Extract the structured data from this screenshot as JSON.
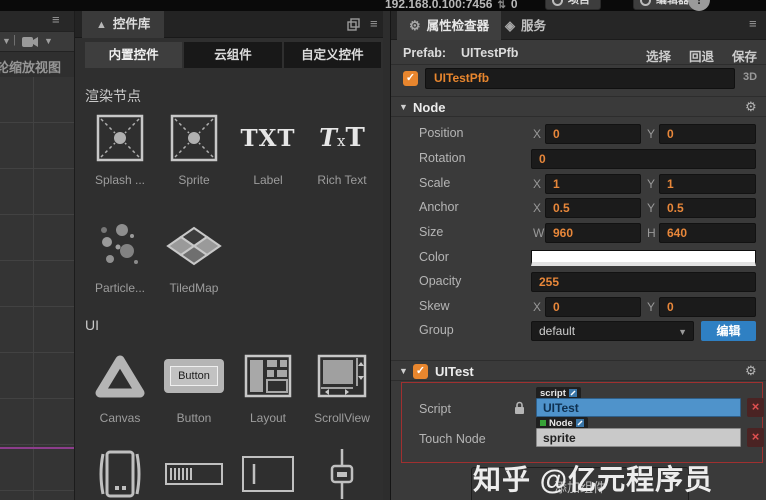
{
  "topbar": {
    "address": "192.168.0.100:7456",
    "count": "0",
    "project": "项目",
    "editor": "编辑器",
    "alert": "!"
  },
  "scene": {
    "hint": "轮缩放视图"
  },
  "library": {
    "title": "控件库",
    "tabs": [
      {
        "label": "内置控件"
      },
      {
        "label": "云组件"
      },
      {
        "label": "自定义控件"
      }
    ],
    "section_render": "渲染节点",
    "section_ui": "UI",
    "items": {
      "splash": "Splash ...",
      "sprite": "Sprite",
      "label": "Label",
      "richtext": "Rich Text",
      "particle": "Particle...",
      "tiledmap": "TiledMap",
      "canvas": "Canvas",
      "button": "Button",
      "layout": "Layout",
      "scrollview": "ScrollView"
    },
    "glyphs": {
      "label": "TXT",
      "rt1": "T",
      "rt2": "x",
      "rt3": "T",
      "button": "Button"
    }
  },
  "inspector": {
    "tab_inspector": "属性检查器",
    "tab_service": "服务",
    "prefab_label": "Prefab:",
    "prefab_name": "UITestPfb",
    "action_select": "选择",
    "action_revert": "回退",
    "action_save": "保存",
    "node_name": "UITestPfb",
    "mode": "3D",
    "node_section": "Node",
    "axis": {
      "x": "X",
      "y": "Y",
      "w": "W",
      "h": "H"
    },
    "rows": {
      "position": {
        "label": "Position",
        "x": "0",
        "y": "0"
      },
      "rotation": {
        "label": "Rotation",
        "value": "0"
      },
      "scale": {
        "label": "Scale",
        "x": "1",
        "y": "1"
      },
      "anchor": {
        "label": "Anchor",
        "x": "0.5",
        "y": "0.5"
      },
      "size": {
        "label": "Size",
        "w": "960",
        "h": "640"
      },
      "color": {
        "label": "Color",
        "value": "#FFFFFF"
      },
      "opacity": {
        "label": "Opacity",
        "value": "255"
      },
      "skew": {
        "label": "Skew",
        "x": "0",
        "y": "0"
      },
      "group": {
        "label": "Group",
        "value": "default",
        "edit": "编辑"
      }
    },
    "uitest": {
      "section": "UITest",
      "script_label": "Script",
      "script_tag": "script",
      "script_value": "UITest",
      "touch_label": "Touch Node",
      "touch_tag": "Node",
      "touch_value": "sprite",
      "remove": "×"
    },
    "add_component": "添加组件"
  },
  "watermark": "知乎 @亿元程序员",
  "icons": {
    "menu": "≡",
    "caret_down": "▼",
    "gear": "⚙",
    "check": "✓",
    "triangle": "▲",
    "service": "◈",
    "updown": "⇅",
    "pipe": "|"
  },
  "colors": {
    "accent_orange": "#e8862e",
    "edit_blue": "#2f80c3",
    "script_blue": "#4f93cb",
    "remove_red": "#e05050",
    "highlight_red": "#a03030",
    "swatch": "#ffffff"
  }
}
